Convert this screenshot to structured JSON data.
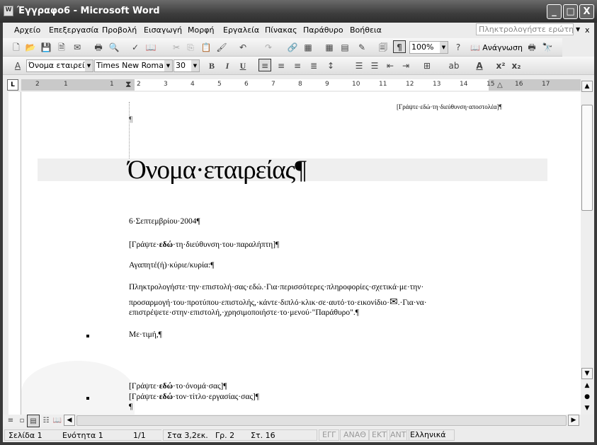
{
  "window": {
    "title": "Έγγραφο6 - Microsoft Word",
    "minimize": "_",
    "maximize": "□",
    "close": "X"
  },
  "menu": {
    "items": [
      "Αρχείο",
      "Επεξεργασία",
      "Προβολή",
      "Εισαγωγή",
      "Μορφή",
      "Εργαλεία",
      "Πίνακας",
      "Παράθυρο",
      "Βοήθεια"
    ],
    "ask_placeholder": "Πληκτρολογήστε ερώτηση",
    "close_doc": "x"
  },
  "standard_toolbar": {
    "zoom": "100%",
    "reading": "Ανάγνωση"
  },
  "formatting_toolbar": {
    "style": "Όνομα εταιρείας",
    "font": "Times New Roman",
    "size": "30",
    "bold": "B",
    "italic": "I",
    "underline": "U"
  },
  "ruler": {
    "marks": [
      "2",
      "1",
      "1",
      "2",
      "3",
      "4",
      "5",
      "6",
      "7",
      "8",
      "9",
      "10",
      "11",
      "12",
      "13",
      "14",
      "15",
      "16",
      "17"
    ]
  },
  "document": {
    "sender_address": "[Γράψτε·εδώ·τη·διεύθυνση·αποστολέα]¶",
    "empty_para": "¶",
    "company_name": "Όνομα·εταιρείας¶",
    "date": "6·Σεπτεμβρίου·2004¶",
    "recipient_prefix": "[Γράψτε·",
    "recipient_bold": "εδώ",
    "recipient_suffix": "·τη·διεύθυνση·του·παραλήπτη]¶",
    "salutation": "Αγαπητέ(ή)·κύριε/κυρία:¶",
    "body_line1": "Πληκτρολογήστε·την·επιστολή·σας·εδώ.·Για·περισσότερες·πληροφορίες·σχετικά·με·την·",
    "body_line2": "προσαρμογή·του·προτύπου·επιστολής,·κάντε·διπλό·κλικ·σε·αυτό·το·εικονίδιο·",
    "body_line2_end": ".·Για·να·",
    "body_line3": "επιστρέψετε·στην·επιστολή,·χρησιμοποιήστε·το·μενού·\"Παράθυρο\".¶",
    "closing": "Με·τιμή,¶",
    "name_prefix": "[Γράψτε·",
    "name_bold": "εδώ",
    "name_suffix": "·το·όνομά·σας]¶",
    "title_prefix": "[Γράψτε·",
    "title_bold": "εδώ",
    "title_suffix": "·τον·τίτλο·εργασίας·σας]¶",
    "last_para": "¶"
  },
  "statusbar": {
    "page": "Σελίδα 1",
    "section": "Ενότητα 1",
    "pages": "1/1",
    "at": "Στα 3,2εκ.",
    "line": "Γρ. 2",
    "col": "Στ. 16",
    "rec": "ΕΓΓ",
    "trk": "ΑΝΑΘ",
    "ext": "ΕΚΤ",
    "ovr": "ΑΝΤ",
    "language": "Ελληνικά"
  }
}
